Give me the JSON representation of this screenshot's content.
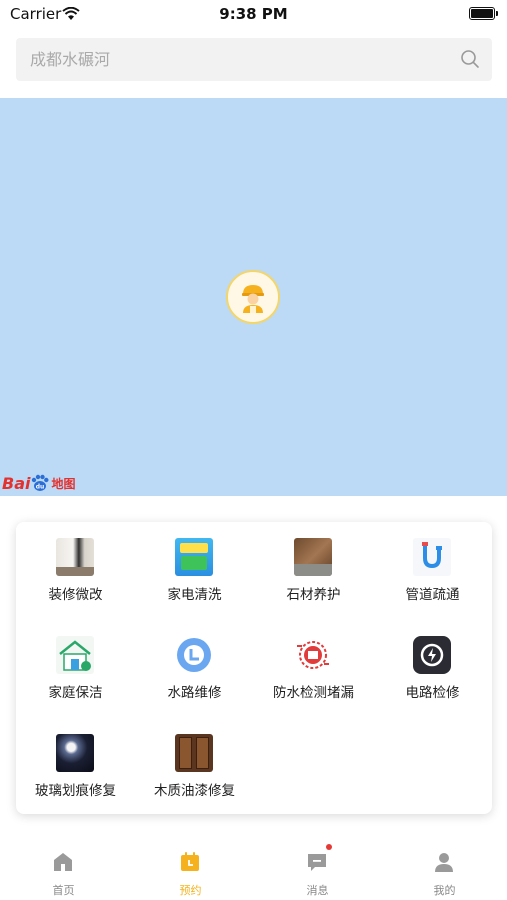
{
  "status_bar": {
    "carrier": "Carrier",
    "time": "9:38 PM"
  },
  "search": {
    "placeholder": "成都水碾河",
    "value": ""
  },
  "map": {
    "logo_text_bai": "Bai",
    "logo_text_map": "地图",
    "marker_icon": "worker-icon"
  },
  "services": [
    {
      "label": "装修微改",
      "icon": "renovation-icon"
    },
    {
      "label": "家电清洗",
      "icon": "appliance-cleaning-icon"
    },
    {
      "label": "石材养护",
      "icon": "stone-care-icon"
    },
    {
      "label": "管道疏通",
      "icon": "pipe-unclog-icon"
    },
    {
      "label": "家庭保洁",
      "icon": "home-cleaning-icon"
    },
    {
      "label": "水路维修",
      "icon": "water-repair-icon"
    },
    {
      "label": "防水检测堵漏",
      "icon": "leak-detection-icon"
    },
    {
      "label": "电路检修",
      "icon": "electric-repair-icon"
    },
    {
      "label": "玻璃划痕修复",
      "icon": "glass-repair-icon"
    },
    {
      "label": "木质油漆修复",
      "icon": "wood-paint-icon"
    }
  ],
  "tabs": [
    {
      "label": "首页",
      "icon": "home-icon",
      "active": false
    },
    {
      "label": "预约",
      "icon": "calendar-icon",
      "active": true
    },
    {
      "label": "消息",
      "icon": "message-icon",
      "active": false,
      "badge": true
    },
    {
      "label": "我的",
      "icon": "user-icon",
      "active": false
    }
  ],
  "colors": {
    "accent": "#f5b21e",
    "map_bg": "#bcd9f6",
    "badge": "#e53935"
  }
}
